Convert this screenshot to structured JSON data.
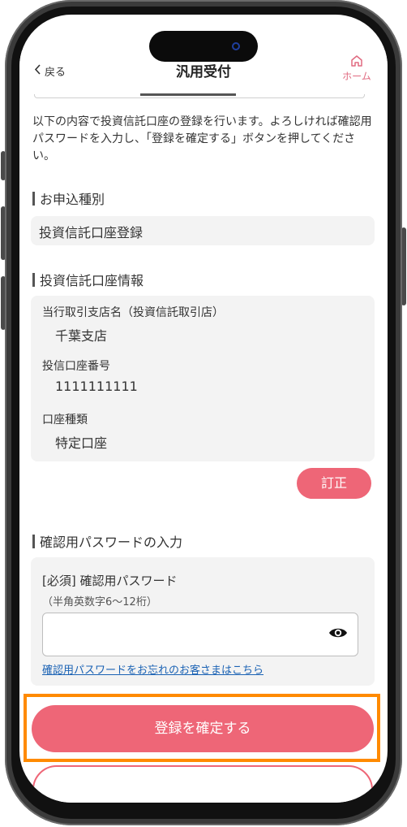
{
  "header": {
    "back_label": "戻る",
    "title": "汎用受付",
    "home_label": "ホーム"
  },
  "intro": "以下の内容で投資信託口座の登録を行います。よろしければ確認用パスワードを入力し、「登録を確定する」ボタンを押してください。",
  "application_type": {
    "heading": "お申込種別",
    "value": "投資信託口座登録"
  },
  "account_info": {
    "heading": "投資信託口座情報",
    "branch_label": "当行取引支店名（投資信託取引店）",
    "branch_value": "千葉支店",
    "account_number_label": "投信口座番号",
    "account_number_value": "1111111111",
    "account_type_label": "口座種類",
    "account_type_value": "特定口座",
    "edit_button": "訂正"
  },
  "password": {
    "heading": "確認用パスワードの入力",
    "field_label": "[必須] 確認用パスワード",
    "hint": "（半角英数字6〜12桁）",
    "value": "",
    "forgot_link": "確認用パスワードをお忘れのお客さまはこちら"
  },
  "actions": {
    "confirm_button": "登録を確定する"
  },
  "colors": {
    "accent": "#ee6677",
    "highlight": "#ff8a00",
    "link": "#1a62b4"
  },
  "icons": {
    "back": "chevron-left-icon",
    "home": "home-icon",
    "eye": "eye-icon"
  }
}
